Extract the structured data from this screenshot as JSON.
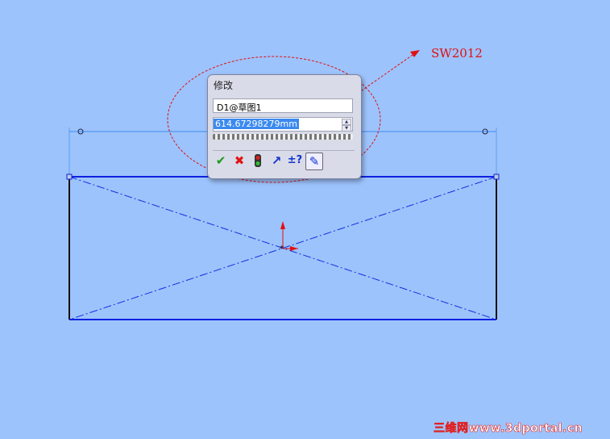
{
  "dialog": {
    "title": "修改",
    "dimension_name": "D1@草图1",
    "value": "614.67298279mm",
    "buttons": [
      {
        "name": "ok",
        "glyph": "✔",
        "color": "#1a9a1a"
      },
      {
        "name": "cancel",
        "glyph": "✖",
        "color": "#e01515"
      },
      {
        "name": "rebuild",
        "glyph": "●",
        "color": "#1a8a1a"
      },
      {
        "name": "reverse",
        "glyph": "↗",
        "color": "#1030d0"
      },
      {
        "name": "tolerance",
        "glyph": "±?",
        "color": "#1030d0"
      },
      {
        "name": "mark-driving",
        "glyph": "✎",
        "color": "#1030d0"
      }
    ]
  },
  "annotation": {
    "label": "SW2012",
    "color": "#e01010"
  },
  "watermark": "三维网www.3dportal.cn"
}
